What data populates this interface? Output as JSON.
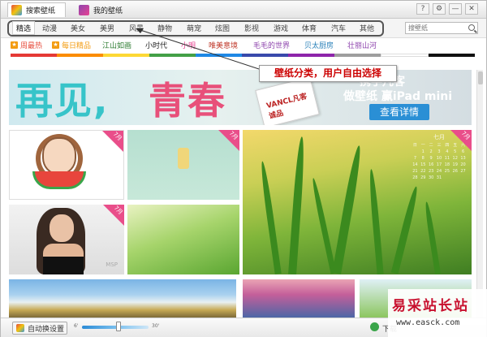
{
  "tabs": [
    {
      "label": "搜索壁纸",
      "icon": "wallpaper-app-icon"
    },
    {
      "label": "我的壁纸",
      "icon": "my-wallpaper-icon"
    }
  ],
  "window_controls": [
    "?",
    "⚙",
    "—",
    "✕"
  ],
  "categories": [
    "精选",
    "动漫",
    "美女",
    "美男",
    "风景",
    "静物",
    "萌宠",
    "炫图",
    "影视",
    "游戏",
    "体育",
    "汽车",
    "其他"
  ],
  "selected_category": "精选",
  "search": {
    "placeholder": "搜壁纸"
  },
  "topics": [
    {
      "label": "周最热",
      "color": "#e74c3c",
      "icon": "hot-icon"
    },
    {
      "label": "每日精品",
      "color": "#f39c12",
      "icon": "daily-icon"
    },
    {
      "label": "江山如画",
      "color": "#2e7d32"
    },
    {
      "label": "小时代",
      "color": "#222222"
    },
    {
      "label": "小明",
      "color": "#e84393"
    },
    {
      "label": "唯美意境",
      "color": "#c0392b"
    },
    {
      "label": "毛毛的世界",
      "color": "#8e44ad"
    },
    {
      "label": "贝太厨房",
      "color": "#2980b9"
    },
    {
      "label": "壮丽山河",
      "color": "#8e44ad"
    }
  ],
  "color_strip": [
    "#e53935",
    "#fb8c00",
    "#fdd835",
    "#43a047",
    "#1e88e5",
    "#3949ab",
    "#8e24aa",
    "#9e9e9e",
    "#ffffff",
    "#111111"
  ],
  "banner": {
    "title_part1": "再见,",
    "title_part2": "青春",
    "package_text": "VANCL凡客诚品",
    "promo_line1": "携手凡客",
    "promo_line2": "做壁纸 赢iPad mini",
    "button": "查看详情"
  },
  "ribbon_label": "7月",
  "calendar": {
    "month": "七月",
    "days": [
      "日",
      "一",
      "二",
      "三",
      "四",
      "五",
      "六",
      "",
      "1",
      "2",
      "3",
      "4",
      "5",
      "6",
      "7",
      "8",
      "9",
      "10",
      "11",
      "12",
      "13",
      "14",
      "15",
      "16",
      "17",
      "18",
      "19",
      "20",
      "21",
      "22",
      "23",
      "24",
      "25",
      "26",
      "27",
      "28",
      "29",
      "30",
      "31"
    ]
  },
  "tile_watermark": "MSP",
  "callout": "壁纸分类，用户自由选择",
  "bottom": {
    "auto_button": "自动换设置",
    "slider_min": "6'",
    "slider_max": "30'",
    "slider_level": 0.55,
    "download_text": "下载"
  },
  "watermark": {
    "line1": "易采站长站",
    "line2": "www.easck.com"
  }
}
